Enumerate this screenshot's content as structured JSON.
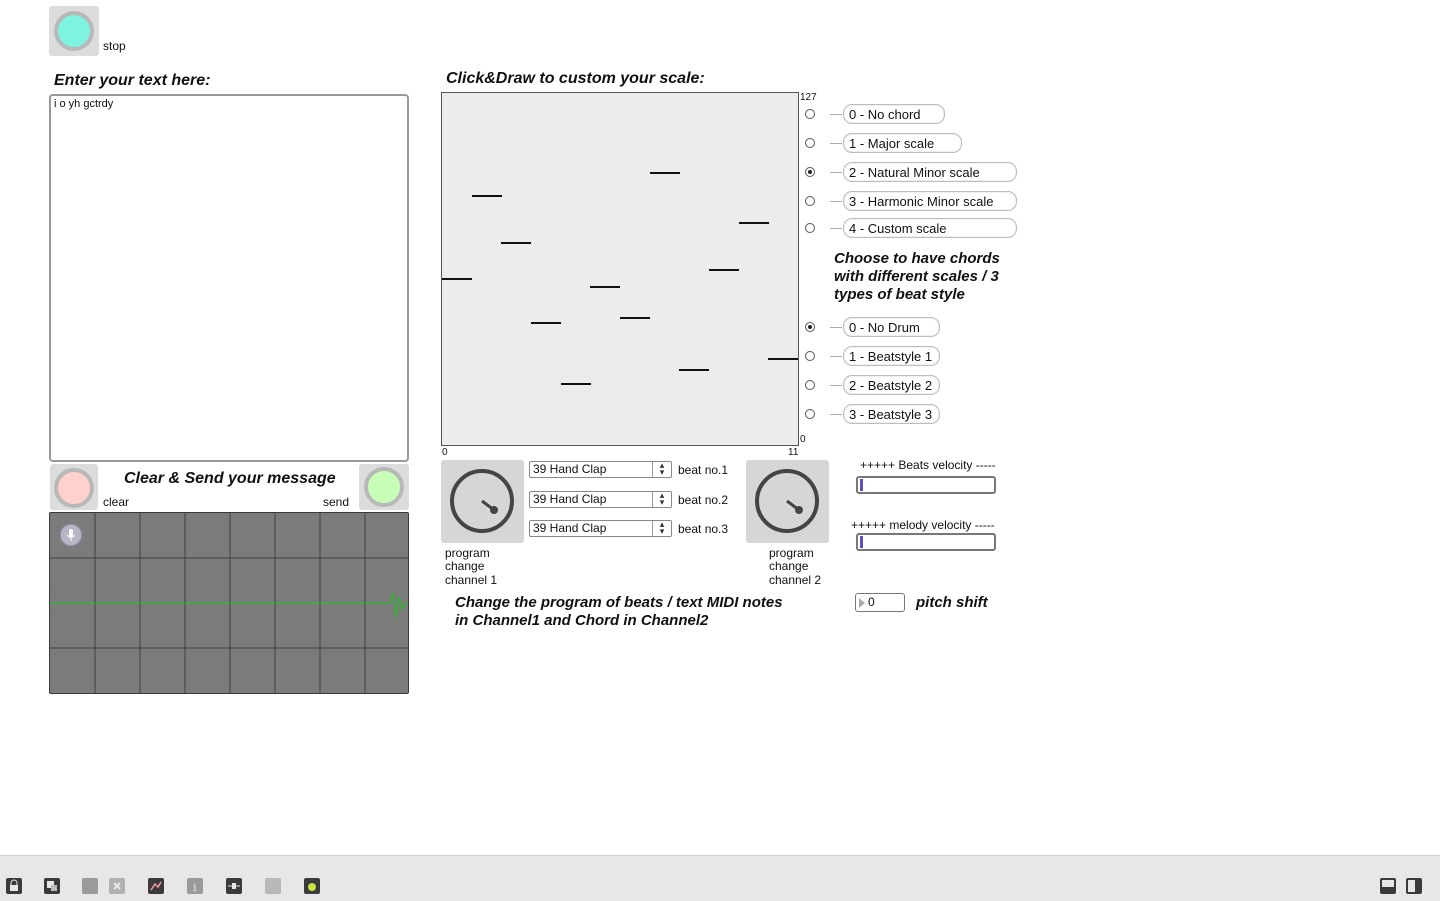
{
  "top": {
    "stop_label": "stop"
  },
  "text_panel": {
    "heading": "Enter your text here:",
    "content": "i o yh gctrdy",
    "clear_send_heading": "Clear & Send your message",
    "clear_label": "clear",
    "send_label": "send"
  },
  "scale_panel": {
    "heading": "Click&Draw to custom your scale:",
    "max_label": "127",
    "min_label": "0",
    "x_start": "0",
    "x_end": "11",
    "notes": [
      60,
      90,
      73,
      44,
      22,
      57,
      46,
      98,
      27,
      63,
      80,
      31
    ]
  },
  "chord_options": {
    "selected": 2,
    "items": [
      "0 - No chord",
      "1 - Major scale",
      "2 - Natural Minor scale",
      "3 - Harmonic Minor scale",
      "4 - Custom scale"
    ]
  },
  "chord_caption": "Choose to have chords with different scales / 3 types of beat style",
  "drum_options": {
    "selected": 0,
    "items": [
      "0 - No Drum",
      "1 - Beatstyle 1",
      "2 - Beatstyle 2",
      "3 - Beatstyle 3"
    ]
  },
  "beats": [
    {
      "value": "39 Hand Clap",
      "label": "beat no.1"
    },
    {
      "value": "39 Hand Clap",
      "label": "beat no.2"
    },
    {
      "value": "39 Hand Clap",
      "label": "beat no.3"
    }
  ],
  "program_change_1": {
    "line1": "program",
    "line2": "change",
    "line3": "channel 1"
  },
  "program_change_2": {
    "line1": "program",
    "line2": "change",
    "line3": "channel 2"
  },
  "bottom_caption": {
    "line1": "Change the program of beats / text MIDI notes",
    "line2": "in Channel1 and Chord in Channel2"
  },
  "beats_velocity_label": "+++++  Beats velocity -----",
  "melody_velocity_label": "+++++  melody velocity -----",
  "pitch_shift": {
    "value": "0",
    "label": "pitch shift"
  },
  "colors": {
    "stop_toggle": "#7ef3e0",
    "clear_toggle": "#ffd0cc",
    "send_toggle": "#c8ffb8",
    "scope_bg": "#7b7b7b",
    "scope_line": "#18c818"
  }
}
